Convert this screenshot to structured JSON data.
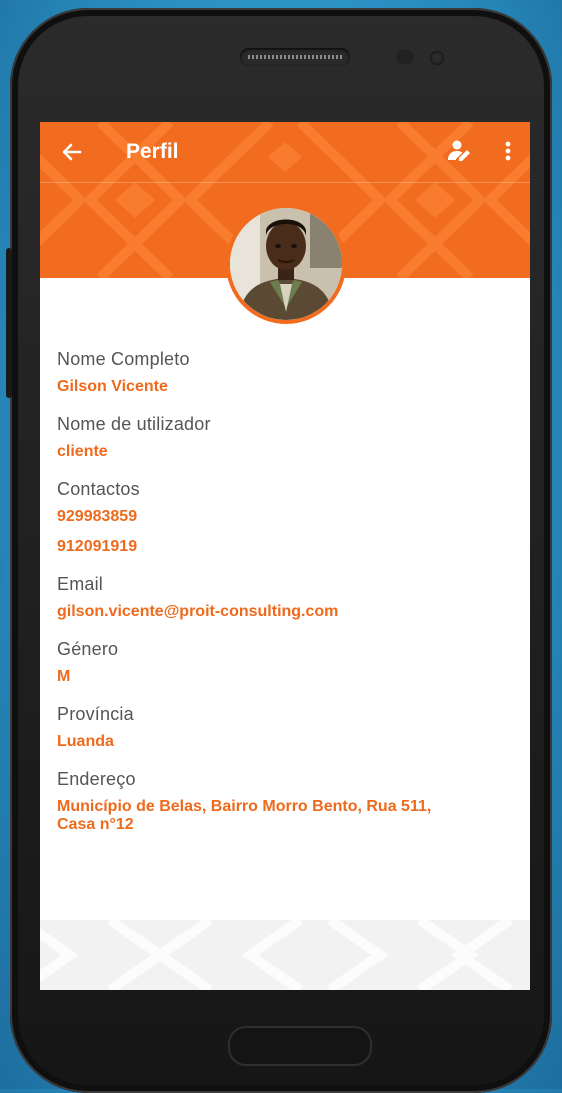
{
  "appbar": {
    "title": "Perfil",
    "back_icon": "arrow-back-icon",
    "edit_icon": "edit-profile-icon",
    "more_icon": "more-vert-icon"
  },
  "colors": {
    "accent": "#f26c1f",
    "label": "#555555",
    "value": "#ee6a1c"
  },
  "profile": {
    "full_name_label": "Nome Completo",
    "full_name": "Gilson Vicente",
    "username_label": "Nome de utilizador",
    "username": "cliente",
    "contacts_label": "Contactos",
    "contacts": [
      "929983859",
      "912091919"
    ],
    "email_label": "Email",
    "email": "gilson.vicente@proit-consulting.com",
    "gender_label": "Género",
    "gender": "M",
    "province_label": "Província",
    "province": "Luanda",
    "address_label": "Endereço",
    "address_line1": "Município de Belas, Bairro Morro Bento, Rua 511,",
    "address_line2": "Casa n°12"
  }
}
